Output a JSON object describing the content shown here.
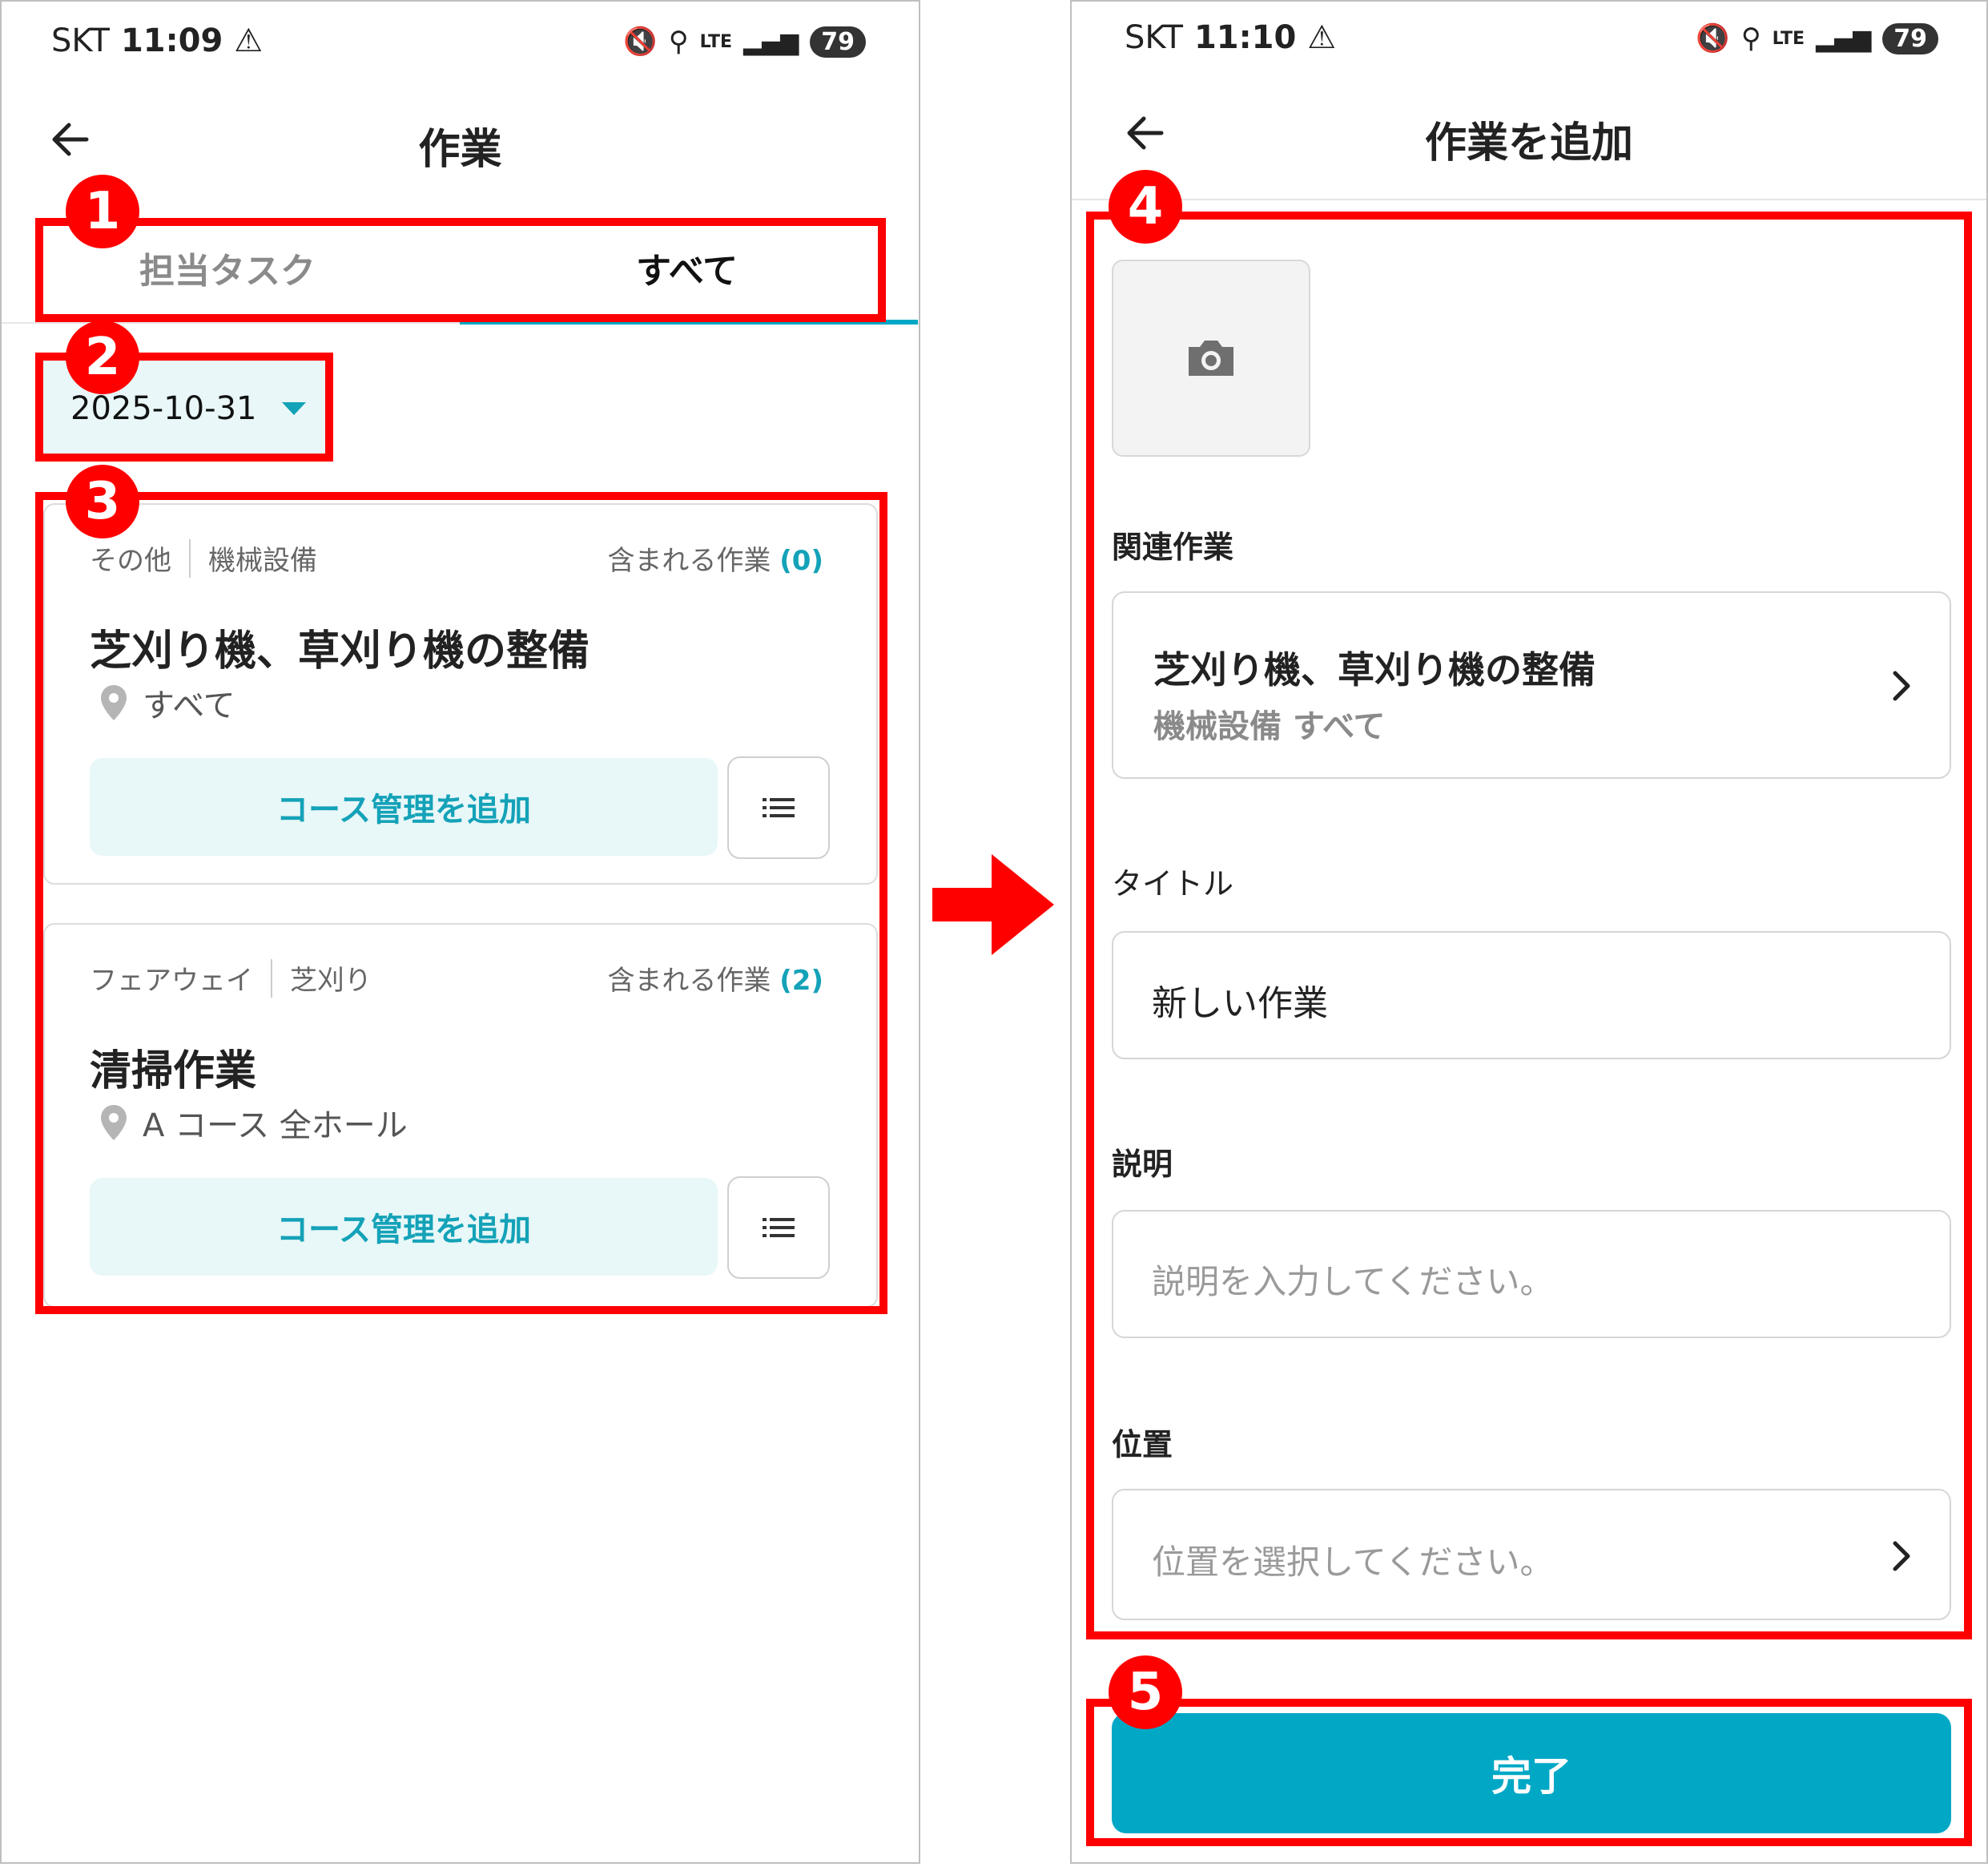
{
  "left": {
    "status": {
      "carrier": "SKT",
      "time": "11:09",
      "battery": "79"
    },
    "header": {
      "title": "作業"
    },
    "tabs": [
      {
        "label": "担当タスク"
      },
      {
        "label": "すべて"
      }
    ],
    "date_filter": {
      "value": "2025-10-31"
    },
    "cards": [
      {
        "category": "その他",
        "subcategory": "機械設備",
        "included_label": "含まれる作業",
        "included_count": "(0)",
        "title": "芝刈り機、草刈り機の整備",
        "location": "すべて",
        "add_button": "コース管理を追加"
      },
      {
        "category": "フェアウェイ",
        "subcategory": "芝刈り",
        "included_label": "含まれる作業",
        "included_count": "(2)",
        "title": "清掃作業",
        "location": "A コース 全ホール",
        "add_button": "コース管理を追加"
      }
    ]
  },
  "right": {
    "status": {
      "carrier": "SKT",
      "time": "11:10",
      "battery": "79"
    },
    "header": {
      "title": "作業を追加"
    },
    "related": {
      "label": "関連作業",
      "title": "芝刈り機、草刈り機の整備",
      "subtitle": "機械設備 すべて"
    },
    "title_field": {
      "label": "タイトル",
      "value": "新しい作業"
    },
    "description_field": {
      "label": "説明",
      "placeholder": "説明を入力してください。"
    },
    "location_field": {
      "label": "位置",
      "placeholder": "位置を選択してください。"
    },
    "done_button": "完了"
  },
  "badges": [
    "1",
    "2",
    "3",
    "4",
    "5"
  ],
  "colors": {
    "accent": "#00a8c6",
    "highlight": "#ff0000"
  }
}
